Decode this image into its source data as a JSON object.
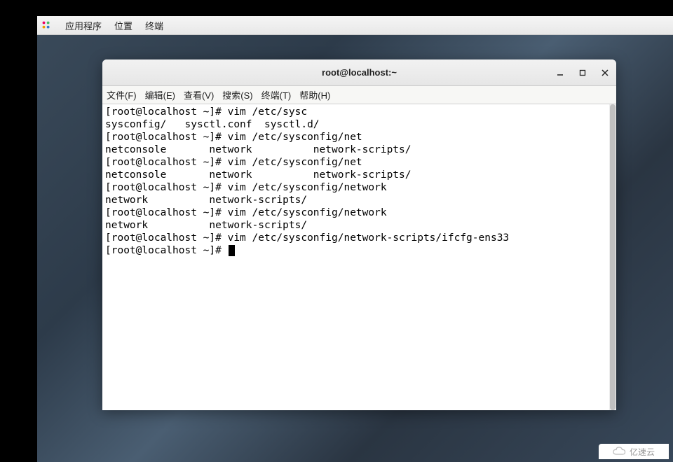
{
  "gnome_topbar": {
    "items": [
      "应用程序",
      "位置",
      "终端"
    ]
  },
  "window": {
    "title": "root@localhost:~",
    "controls": {
      "minimize": "—",
      "maximize": "□",
      "close": "×"
    }
  },
  "menubar": {
    "items": [
      "文件(F)",
      "编辑(E)",
      "查看(V)",
      "搜索(S)",
      "终端(T)",
      "帮助(H)"
    ]
  },
  "terminal": {
    "lines": [
      "[root@localhost ~]# vim /etc/sysc",
      "sysconfig/   sysctl.conf  sysctl.d/",
      "[root@localhost ~]# vim /etc/sysconfig/net",
      "netconsole       network          network-scripts/",
      "[root@localhost ~]# vim /etc/sysconfig/net",
      "netconsole       network          network-scripts/",
      "[root@localhost ~]# vim /etc/sysconfig/network",
      "network          network-scripts/",
      "[root@localhost ~]# vim /etc/sysconfig/network",
      "network          network-scripts/",
      "[root@localhost ~]# vim /etc/sysconfig/network-scripts/ifcfg-ens33",
      "[root@localhost ~]# "
    ]
  },
  "watermark": {
    "text": "亿速云"
  }
}
